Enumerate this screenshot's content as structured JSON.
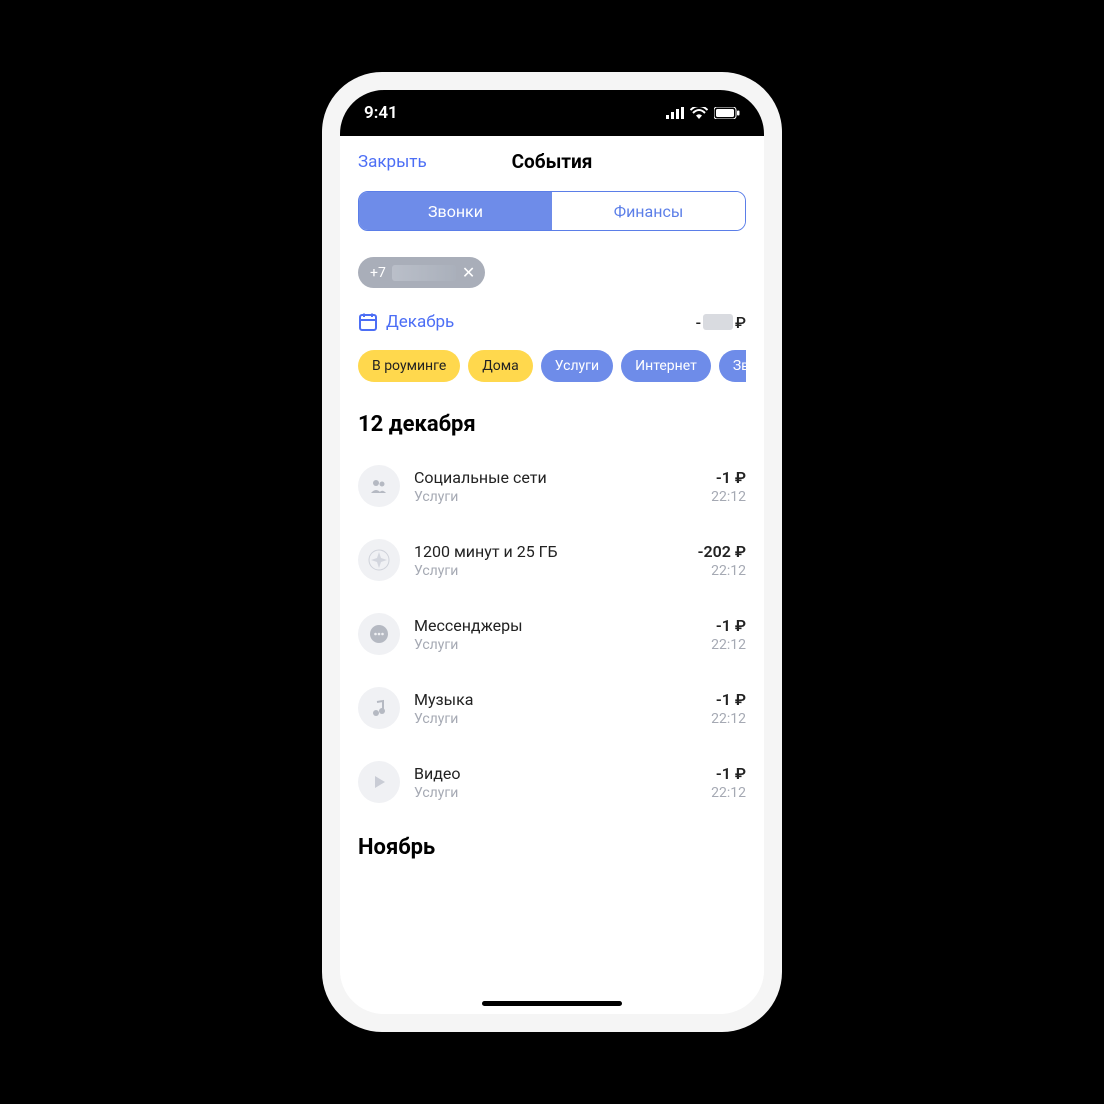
{
  "status_bar": {
    "time": "9:41"
  },
  "nav": {
    "close_label": "Закрыть",
    "title": "События"
  },
  "segmented": {
    "tab_calls": "Звонки",
    "tab_finance": "Финансы"
  },
  "phone_chip": {
    "prefix": "+7"
  },
  "month_row": {
    "month": "Декабрь",
    "amount_prefix": "-",
    "ruble": "₽"
  },
  "filter_chips": {
    "roaming": "В роуминге",
    "home": "Дома",
    "services": "Услуги",
    "internet": "Интернет",
    "calls": "Звонк"
  },
  "sections": [
    {
      "header": "12 декабря",
      "items": [
        {
          "icon": "people-icon",
          "title": "Социальные сети",
          "subtitle": "Услуги",
          "amount": "-1 ₽",
          "time": "22:12"
        },
        {
          "icon": "plan-icon",
          "title": "1200 минут и 25 ГБ",
          "subtitle": "Услуги",
          "amount": "-202 ₽",
          "time": "22:12"
        },
        {
          "icon": "chat-icon",
          "title": "Мессенджеры",
          "subtitle": "Услуги",
          "amount": "-1 ₽",
          "time": "22:12"
        },
        {
          "icon": "music-icon",
          "title": "Музыка",
          "subtitle": "Услуги",
          "amount": "-1 ₽",
          "time": "22:12"
        },
        {
          "icon": "play-icon",
          "title": "Видео",
          "subtitle": "Услуги",
          "amount": "-1 ₽",
          "time": "22:12"
        }
      ]
    },
    {
      "header": "Ноябрь",
      "items": []
    }
  ]
}
